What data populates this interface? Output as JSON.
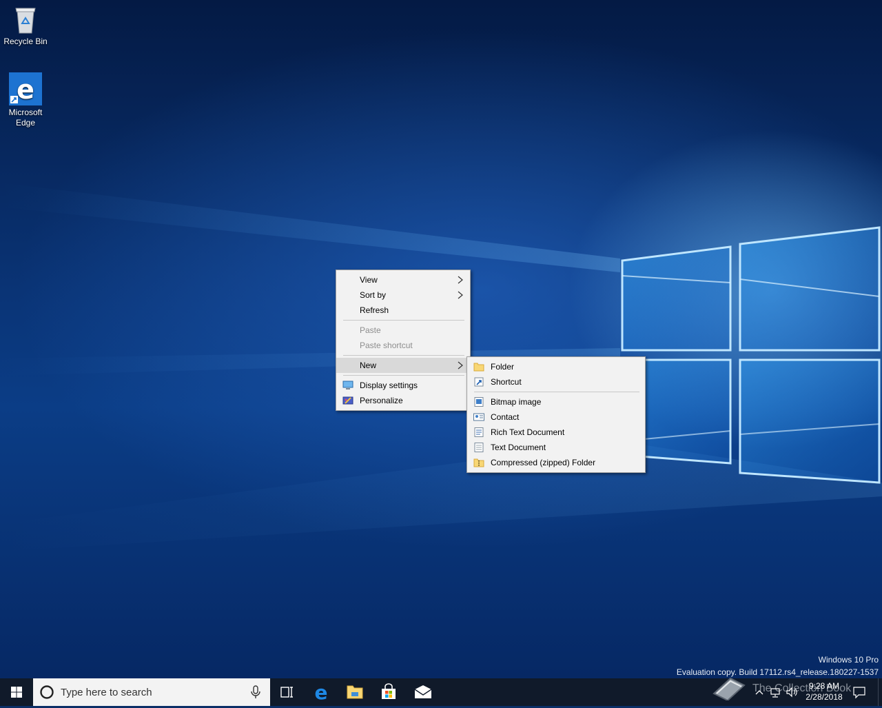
{
  "desktop": {
    "icons": [
      {
        "label": "Recycle Bin",
        "icon": "recycle-bin-icon"
      },
      {
        "label": "Microsoft\nEdge",
        "label_line1": "Microsoft",
        "label_line2": "Edge",
        "icon": "edge-icon"
      }
    ],
    "watermark": {
      "line1": "Windows 10 Pro",
      "line2": "Evaluation copy. Build 17112.rs4_release.180227-1537"
    }
  },
  "context_menu": {
    "items": [
      {
        "label": "View",
        "submenu": true
      },
      {
        "label": "Sort by",
        "submenu": true
      },
      {
        "label": "Refresh"
      },
      {
        "label": "Paste",
        "disabled": true
      },
      {
        "label": "Paste shortcut",
        "disabled": true
      },
      {
        "label": "New",
        "submenu": true,
        "highlighted": true
      },
      {
        "label": "Display settings",
        "icon": "display-settings-icon"
      },
      {
        "label": "Personalize",
        "icon": "personalize-icon"
      }
    ]
  },
  "new_submenu": {
    "items": [
      {
        "label": "Folder",
        "icon": "folder-icon"
      },
      {
        "label": "Shortcut",
        "icon": "shortcut-icon"
      },
      {
        "label": "Bitmap image",
        "icon": "bitmap-icon"
      },
      {
        "label": "Contact",
        "icon": "contact-icon"
      },
      {
        "label": "Rich Text Document",
        "icon": "rich-text-icon"
      },
      {
        "label": "Text Document",
        "icon": "text-document-icon"
      },
      {
        "label": "Compressed (zipped) Folder",
        "icon": "zip-folder-icon"
      }
    ]
  },
  "taskbar": {
    "search_placeholder": "Type here to search",
    "pinned": [
      "task-view-icon",
      "edge-icon",
      "file-explorer-icon",
      "store-icon",
      "mail-icon"
    ],
    "tray": {
      "time": "9:28 AM",
      "date": "2/28/2018",
      "overlay_text": "The Collection Book"
    }
  },
  "colors": {
    "accent": "#0078d7",
    "menu_bg": "#f2f2f2",
    "menu_hover": "#d9d9d9",
    "taskbar": "#101a2a"
  }
}
